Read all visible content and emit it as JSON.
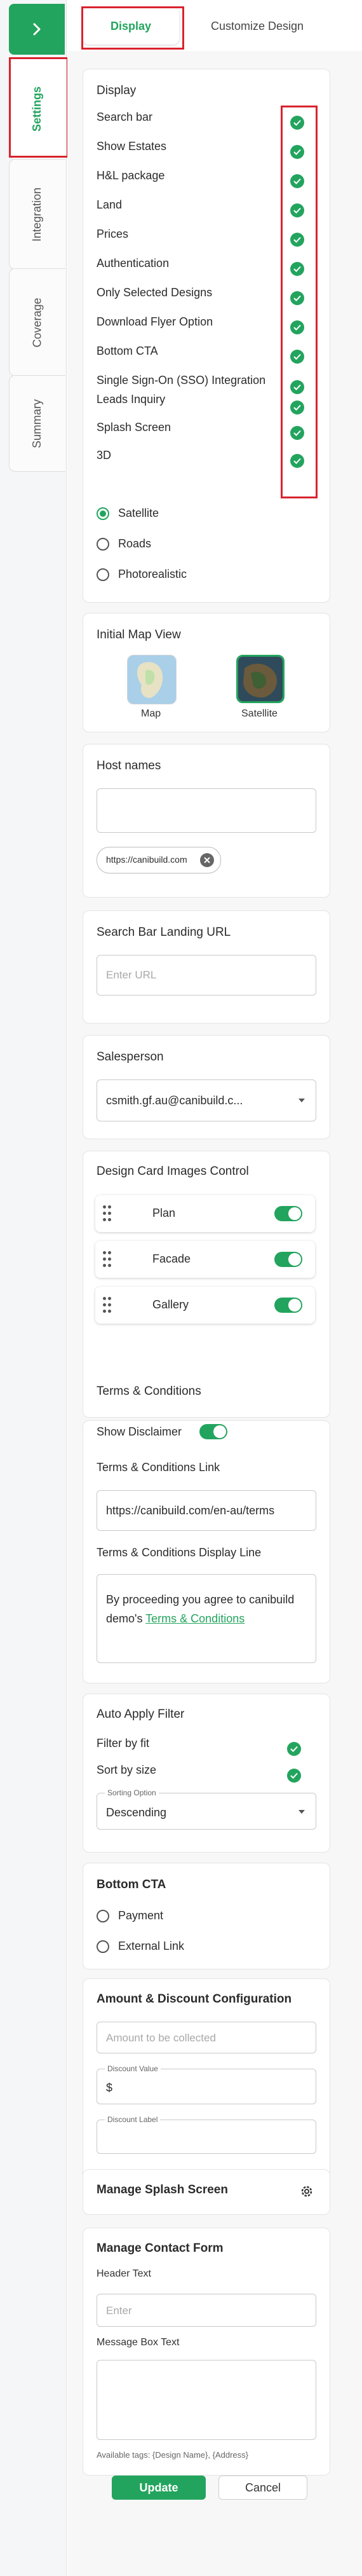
{
  "nav": {
    "collapse_icon": "chevron-right-icon",
    "tabs": [
      {
        "label": "Settings",
        "active": true
      },
      {
        "label": "Integration",
        "active": false
      },
      {
        "label": "Coverage",
        "active": false
      },
      {
        "label": "Summary",
        "active": false
      }
    ]
  },
  "top_tabs": [
    {
      "label": "Display",
      "active": true
    },
    {
      "label": "Customize Design",
      "active": false
    }
  ],
  "display": {
    "title": "Display",
    "items": [
      {
        "label": "Search bar",
        "checked": true
      },
      {
        "label": "Show Estates",
        "checked": true
      },
      {
        "label": "H&L package",
        "checked": true
      },
      {
        "label": "Land",
        "checked": true
      },
      {
        "label": "Prices",
        "checked": true
      },
      {
        "label": "Authentication",
        "checked": true
      },
      {
        "label": "Only Selected Designs",
        "checked": true
      },
      {
        "label": "Download Flyer Option",
        "checked": true
      },
      {
        "label": "Bottom CTA",
        "checked": true
      },
      {
        "label": "Single Sign-On (SSO) Integration",
        "checked": true
      },
      {
        "label": "Leads Inquiry",
        "checked": true
      },
      {
        "label": "Splash Screen",
        "checked": true
      },
      {
        "label": "3D",
        "checked": true
      }
    ],
    "map_style": {
      "options": [
        "Satellite",
        "Roads",
        "Photorealistic"
      ],
      "selected": "Satellite"
    }
  },
  "initial_map_view": {
    "title": "Initial Map View",
    "options": [
      {
        "label": "Map",
        "selected": false
      },
      {
        "label": "Satellite",
        "selected": true
      }
    ]
  },
  "host_names": {
    "title": "Host names",
    "input_value": "",
    "chips": [
      "https://canibuild.com"
    ]
  },
  "search_bar_landing": {
    "title": "Search Bar Landing URL",
    "placeholder": "Enter URL"
  },
  "salesperson": {
    "title": "Salesperson",
    "value": "csmith.gf.au@canibuild.c..."
  },
  "design_card_images": {
    "title": "Design Card Images Control",
    "rows": [
      {
        "label": "Plan",
        "enabled": true
      },
      {
        "label": "Facade",
        "enabled": true
      },
      {
        "label": "Gallery",
        "enabled": true
      }
    ]
  },
  "terms": {
    "title": "Terms & Conditions",
    "show_disclaimer_label": "Show Disclaimer",
    "show_disclaimer": true,
    "link_label": "Terms & Conditions Link",
    "link_value": "https://canibuild.com/en-au/terms",
    "display_line_label": "Terms & Conditions Display Line",
    "display_line_text": "By proceeding you agree to canibuild demo's",
    "display_line_link": "Terms & Conditions"
  },
  "auto_apply_filter": {
    "title": "Auto Apply Filter",
    "items": [
      {
        "label": "Filter by fit",
        "checked": true
      },
      {
        "label": "Sort by size",
        "checked": true
      }
    ],
    "sorting_label": "Sorting Option",
    "sorting_value": "Descending"
  },
  "bottom_cta": {
    "title": "Bottom CTA",
    "options": [
      "Payment",
      "External Link"
    ],
    "selected": null
  },
  "amount_discount": {
    "title": "Amount & Discount Configuration",
    "amount_placeholder": "Amount to be collected",
    "discount_value_label": "Discount Value",
    "discount_value_prefix": "$",
    "discount_label_label": "Discount Label"
  },
  "splash": {
    "title": "Manage Splash Screen",
    "icon": "gear-icon"
  },
  "contact_form": {
    "title": "Manage Contact Form",
    "header_label": "Header Text",
    "header_placeholder": "Enter",
    "message_label": "Message Box Text",
    "tags_hint": "Available tags: {Design Name}, {Address}"
  },
  "footer": {
    "update_label": "Update",
    "cancel_label": "Cancel"
  },
  "colors": {
    "accent": "#23a45e",
    "annotation_red": "#d9232e"
  }
}
